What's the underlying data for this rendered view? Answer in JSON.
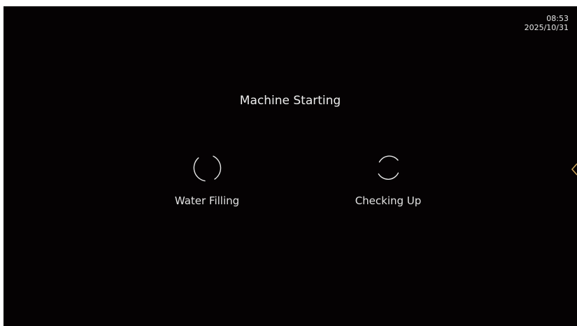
{
  "status_bar": {
    "time": "08:53",
    "date": "2025/10/31"
  },
  "main": {
    "title": "Machine Starting",
    "steps": [
      {
        "label": "Water Filling",
        "icon": "loading-spinner-icon"
      },
      {
        "label": "Checking Up",
        "icon": "loading-spinner-icon"
      }
    ]
  },
  "colors": {
    "background": "#050203",
    "text": "#ededed",
    "accent": "#c9a25a"
  }
}
